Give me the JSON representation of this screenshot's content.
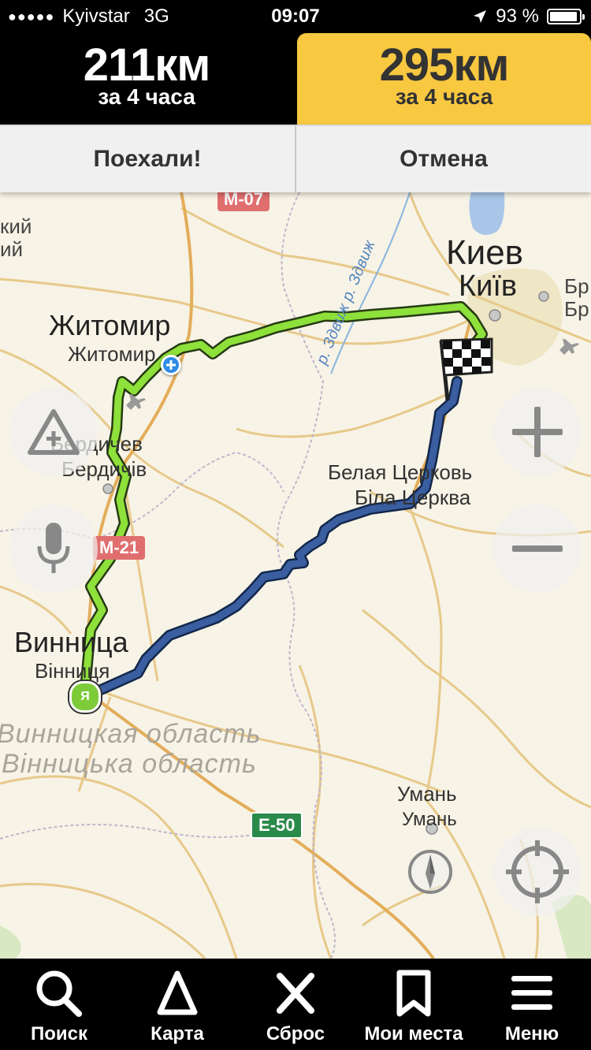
{
  "status_bar": {
    "carrier": "Kyivstar",
    "network": "3G",
    "time": "09:07",
    "battery_percent": "93 %",
    "battery_level": 0.93
  },
  "routes": [
    {
      "distance": "211км",
      "duration": "за 4 часа",
      "selected": false
    },
    {
      "distance": "295км",
      "duration": "за 4 часа",
      "selected": true
    }
  ],
  "actions": {
    "go": "Поехали!",
    "cancel": "Отмена"
  },
  "map": {
    "cities": {
      "kiev": {
        "ru": "Киев",
        "ua": "Київ"
      },
      "zhytomyr": {
        "ru": "Житомир",
        "ua": "Житомир"
      },
      "berdychiv": {
        "ru": "Бердичев",
        "ua": "Бердичів"
      },
      "bila_tserkva": {
        "ru": "Белая Церковь",
        "ua": "Біла Церква"
      },
      "vinnytsia": {
        "ru": "Винница",
        "ua": "Вінниця"
      },
      "uman": {
        "ru": "Умань",
        "ua": "Умань"
      },
      "left_edge": {
        "line1": "кий",
        "line2": "ий"
      },
      "right_edge": {
        "line1": "Бр",
        "line2": "Бр"
      }
    },
    "region": {
      "ru": "Винницкая область",
      "ua": "Вінницька область"
    },
    "roads": {
      "m07": "М-07",
      "m21": "М-21",
      "e50": "Е-50"
    },
    "river": "р. Здвиж  р. Здвиж",
    "route_colors": {
      "primary": "#7ed321",
      "alternative": "#3a5ea0"
    }
  },
  "tabbar": [
    {
      "label": "Поиск",
      "icon": "search-icon"
    },
    {
      "label": "Карта",
      "icon": "map-arrow-icon"
    },
    {
      "label": "Сброс",
      "icon": "close-icon"
    },
    {
      "label": "Мои места",
      "icon": "bookmark-icon"
    },
    {
      "label": "Меню",
      "icon": "menu-icon"
    }
  ]
}
